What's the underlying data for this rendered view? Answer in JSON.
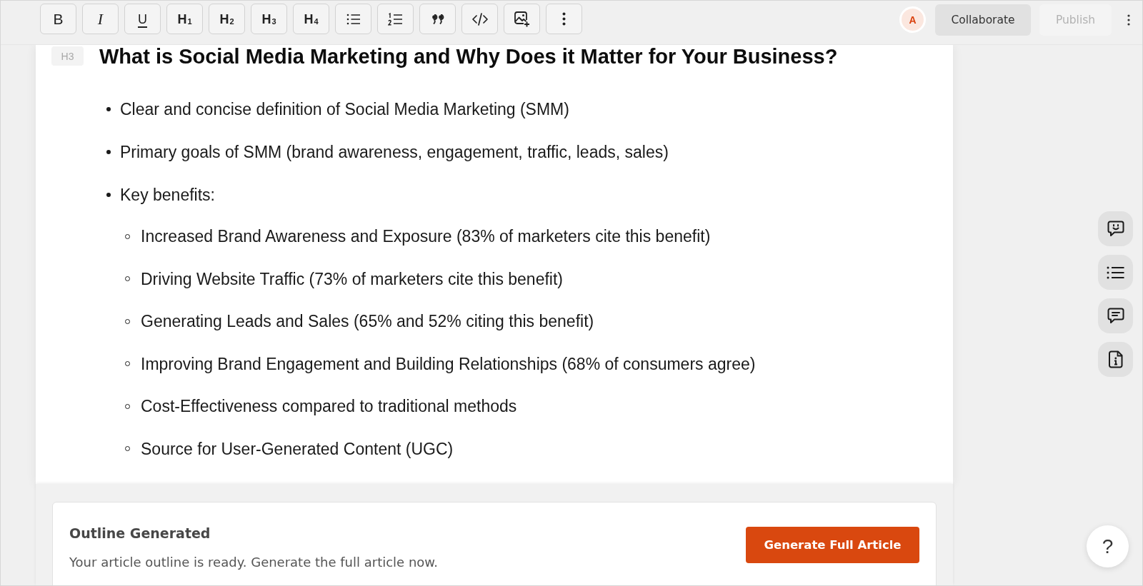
{
  "toolbar": {
    "format_buttons": [
      {
        "kind": "bold",
        "label": "B"
      },
      {
        "kind": "italic",
        "label": "I"
      },
      {
        "kind": "underline",
        "label": "U"
      },
      {
        "kind": "heading",
        "label": "H$_{1}$"
      },
      {
        "kind": "heading",
        "label": "H$_{2}$"
      },
      {
        "kind": "heading",
        "label": "H$_{3}$"
      },
      {
        "kind": "heading",
        "label": "H$_{4}$"
      }
    ],
    "avatar": {
      "initial": "A"
    },
    "collaborate_button": {
      "label": "Collaborate"
    },
    "publish_button": {
      "label": "Publish",
      "disabled": true
    }
  },
  "editor": {
    "heading": {
      "badge": "H3",
      "text": "What is Social Media Marketing and Why Does it Matter for Your Business?"
    },
    "outline": [
      {
        "text": "Clear and concise definition of Social Media Marketing (SMM)"
      },
      {
        "text": "Primary goals of SMM (brand awareness, engagement, traffic, leads, sales)"
      },
      {
        "text": "Key benefits:",
        "children": [
          {
            "text": "Increased Brand Awareness and Exposure (83% of marketers cite this benefit)"
          },
          {
            "text": "Driving Website Traffic (73% of marketers cite this benefit)"
          },
          {
            "text": "Generating Leads and Sales (65% and 52% citing this benefit)"
          },
          {
            "text": "Improving Brand Engagement and Building Relationships (68% of consumers agree)"
          },
          {
            "text": "Cost-Effectiveness compared to traditional methods"
          },
          {
            "text": "Source for User-Generated Content (UGC)"
          }
        ]
      }
    ]
  },
  "outline_banner": {
    "title": "Outline Generated",
    "message": "Your article outline is ready. Generate the full article now.",
    "button": "Generate Full Article"
  },
  "help_button": {
    "label": "?"
  }
}
